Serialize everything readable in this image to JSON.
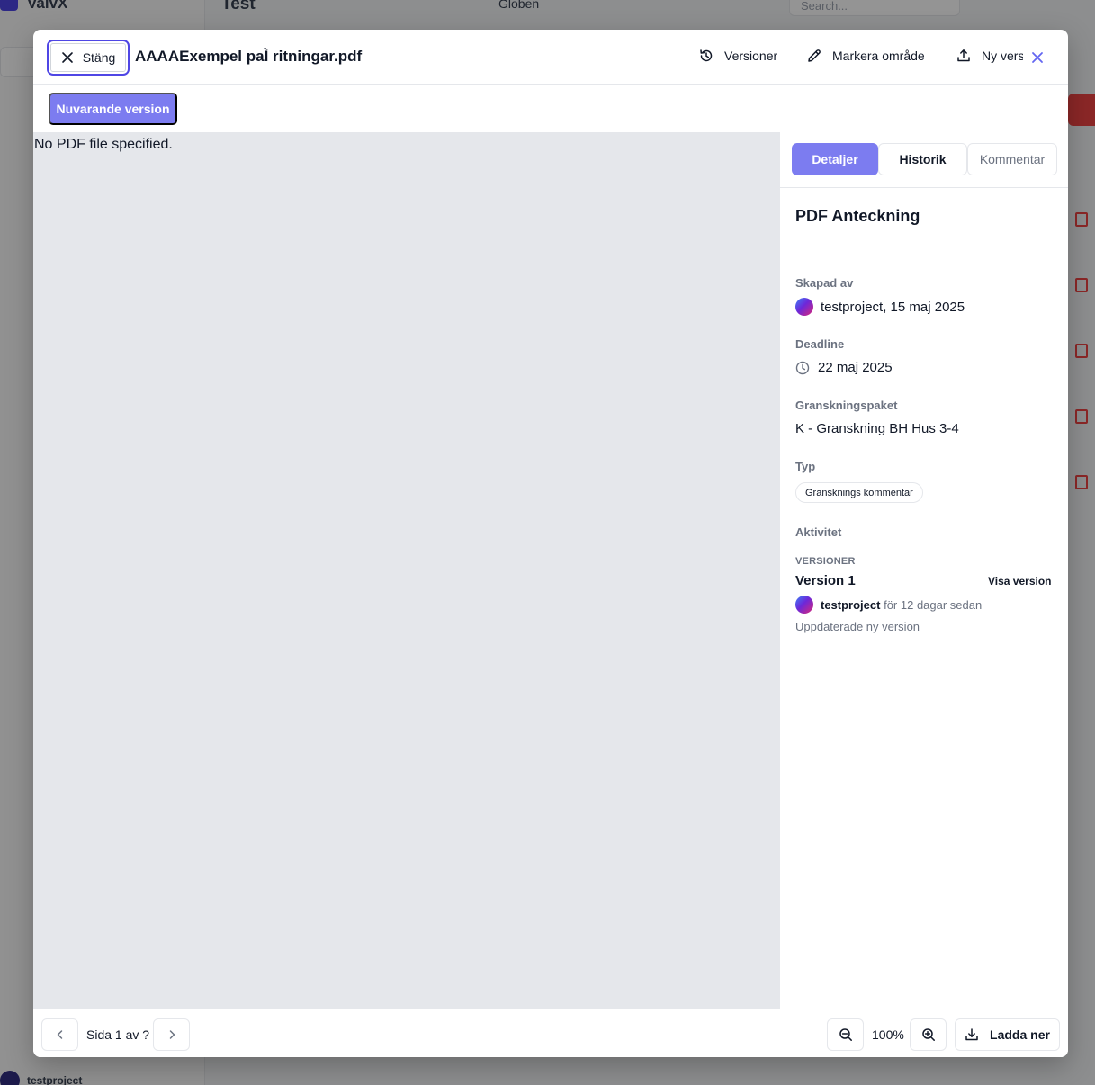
{
  "background": {
    "brand": "ValvX",
    "project_title": "Test",
    "view_selector": "Globen",
    "search_placeholder": "Search...",
    "user_name": "testproject"
  },
  "header": {
    "close_label": "Stäng",
    "file_name": "AAAAExempel paÌ ritningar.pdf",
    "actions": {
      "versions": "Versioner",
      "mark_area": "Markera område",
      "new_version": "Ny version"
    }
  },
  "version_bar": {
    "current_version": "Nuvarande version"
  },
  "viewer": {
    "message": "No PDF file specified."
  },
  "sidebar": {
    "tabs": [
      {
        "label": "Detaljer",
        "active": true
      },
      {
        "label": "Historik",
        "active": false
      },
      {
        "label": "Kommentar",
        "active": false
      }
    ],
    "title": "PDF Anteckning",
    "created_by_label": "Skapad av",
    "created_by_value": "testproject, 15 maj 2025",
    "deadline_label": "Deadline",
    "deadline_value": "22 maj 2025",
    "package_label": "Granskningspaket",
    "package_value": "K - Granskning BH Hus 3-4",
    "type_label": "Typ",
    "type_value": "Gransknings kommentar",
    "activity_label": "Aktivitet",
    "versions_heading": "VERSIONER",
    "versions": [
      {
        "name": "Version 1",
        "show_label": "Visa version",
        "user": "testproject",
        "time": "för 12 dagar sedan",
        "note": "Uppdaterade ny version"
      }
    ]
  },
  "footer": {
    "page_label": "Sida 1 av ?",
    "zoom": "100%",
    "download_label": "Ladda ner"
  },
  "colors": {
    "accent": "#7c7cf0",
    "focus_ring": "#4f46e5",
    "viewer_bg": "#e5e7eb",
    "muted_text": "#6b7280"
  }
}
